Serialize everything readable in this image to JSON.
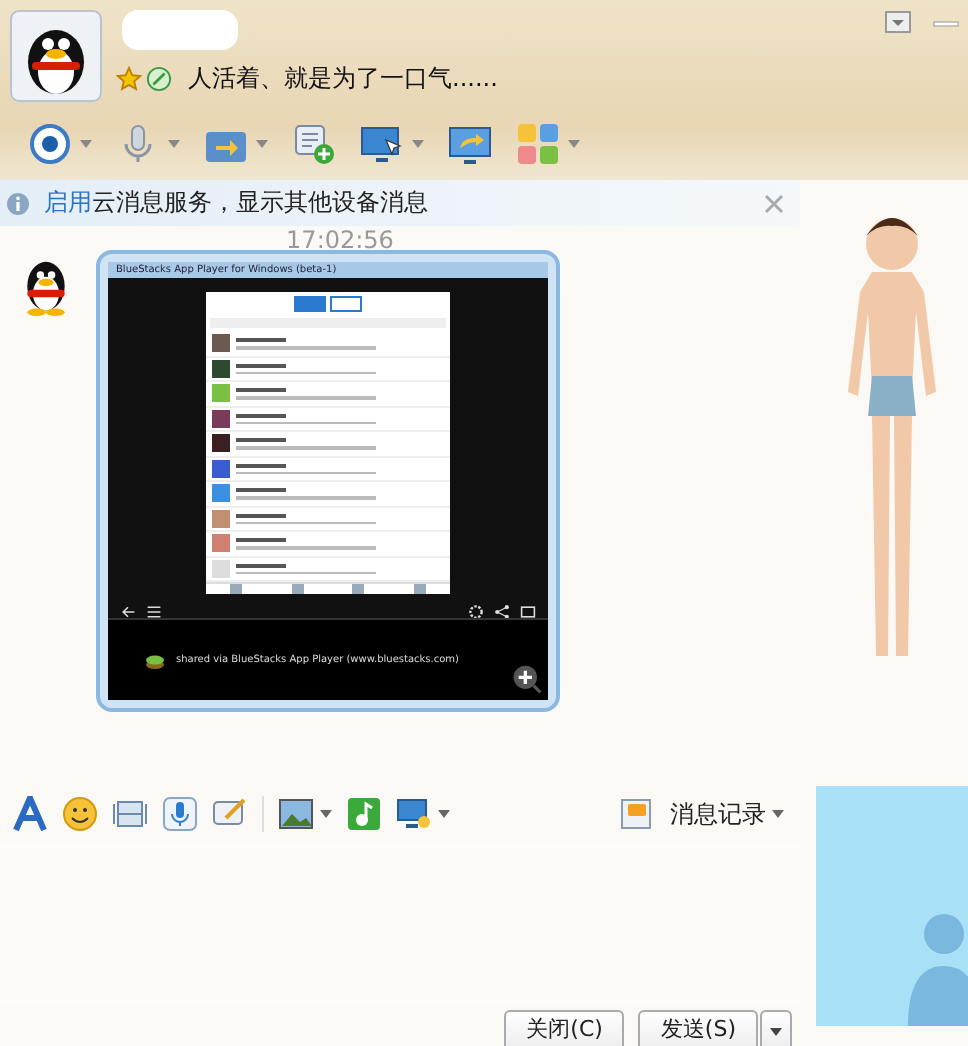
{
  "contact": {
    "signature": "人活着、就是为了一口气......"
  },
  "notice": {
    "link": "启用",
    "text": "云消息服务，显示其他设备消息"
  },
  "messages": [
    {
      "time": "17:02:56",
      "image": {
        "title": "BlueStacks App Player for Windows (beta-1)",
        "caption": "shared via BlueStacks App Player (www.bluestacks.com)"
      }
    }
  ],
  "history_button": "消息记录",
  "buttons": [
    {
      "label": "关闭(C)"
    },
    {
      "label": "发送(S)"
    }
  ]
}
